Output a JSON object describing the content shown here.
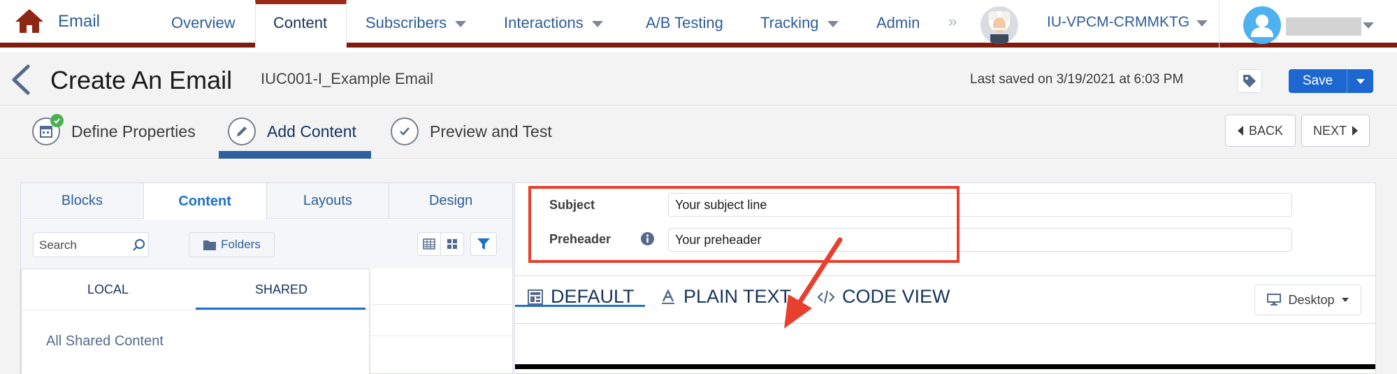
{
  "topnav": {
    "app_name": "Email",
    "items": [
      {
        "label": "Overview"
      },
      {
        "label": "Content"
      },
      {
        "label": "Subscribers"
      },
      {
        "label": "Interactions"
      },
      {
        "label": "A/B Testing"
      },
      {
        "label": "Tracking"
      },
      {
        "label": "Admin"
      }
    ],
    "active_item": "Content",
    "more_glyph": "»",
    "business_unit": "IU-VPCM-CRMMKTG",
    "brand_color": "#7f1c0e"
  },
  "titlebar": {
    "title": "Create An Email",
    "email_name": "IUC001-I_Example Email",
    "saved_status": "Last saved on 3/19/2021 at 6:03 PM",
    "save_label": "Save",
    "save_color": "#1d67d0"
  },
  "steps": {
    "items": [
      {
        "label": "Define Properties",
        "icon": "calendar-icon",
        "state": "complete"
      },
      {
        "label": "Add Content",
        "icon": "pencil-icon",
        "state": "active"
      },
      {
        "label": "Preview and Test",
        "icon": "check-icon",
        "state": "pending"
      }
    ],
    "back_label": "BACK",
    "next_label": "NEXT"
  },
  "left_panel": {
    "tabs": [
      {
        "label": "Blocks"
      },
      {
        "label": "Content"
      },
      {
        "label": "Layouts"
      },
      {
        "label": "Design"
      }
    ],
    "active_tab": "Content",
    "search_placeholder": "Search",
    "folders_label": "Folders",
    "scope_tabs": [
      {
        "label": "LOCAL"
      },
      {
        "label": "SHARED"
      }
    ],
    "active_scope": "SHARED",
    "scope_items": [
      "All Shared Content"
    ]
  },
  "right_panel": {
    "subject_label": "Subject",
    "subject_value": "Your subject line",
    "preheader_label": "Preheader",
    "preheader_value": "Your preheader",
    "editor_tabs": [
      {
        "label": "DEFAULT",
        "icon": "layout-icon"
      },
      {
        "label": "PLAIN TEXT",
        "icon": "text-format-icon"
      },
      {
        "label": "CODE VIEW",
        "icon": "code-icon"
      }
    ],
    "active_editor_tab": "DEFAULT",
    "device_label": "Desktop",
    "annotation_color": "#e8402e"
  }
}
